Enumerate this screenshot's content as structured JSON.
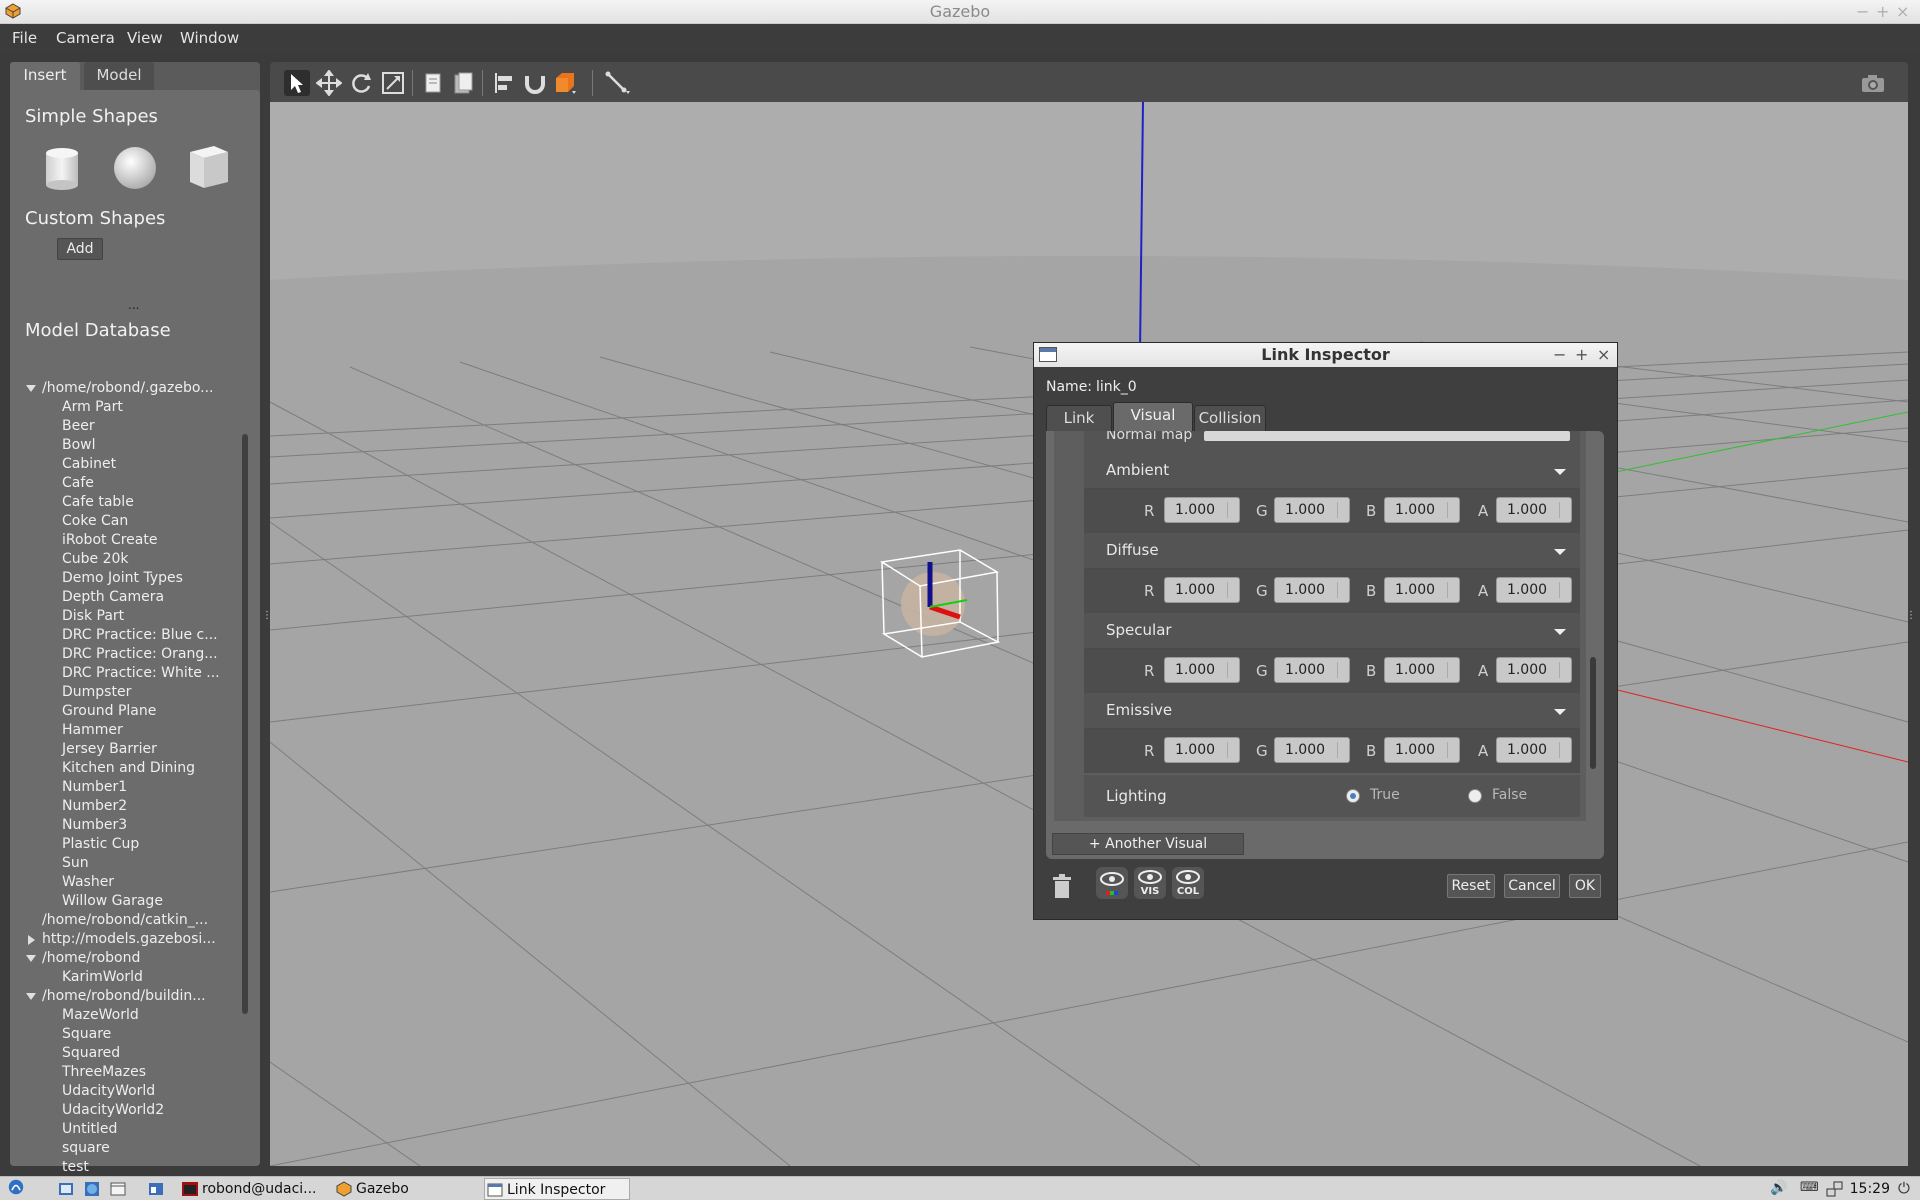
{
  "window": {
    "title": "Gazebo"
  },
  "menu": [
    {
      "label": "File",
      "mnemonic": "F"
    },
    {
      "label": "Camera",
      "mnemonic": "C"
    },
    {
      "label": "View",
      "mnemonic": "V"
    },
    {
      "label": "Window",
      "mnemonic": "W"
    }
  ],
  "left_panel": {
    "tabs": [
      "Insert",
      "Model"
    ],
    "simple_shapes_title": "Simple Shapes",
    "custom_shapes_title": "Custom Shapes",
    "add_label": "Add",
    "splitter": "...",
    "model_database_title": "Model Database",
    "tree": [
      {
        "label": "/home/robond/.gazebo...",
        "level": 0,
        "arrow": "down"
      },
      {
        "label": "Arm Part",
        "level": 1
      },
      {
        "label": "Beer",
        "level": 1
      },
      {
        "label": "Bowl",
        "level": 1
      },
      {
        "label": "Cabinet",
        "level": 1
      },
      {
        "label": "Cafe",
        "level": 1
      },
      {
        "label": "Cafe table",
        "level": 1
      },
      {
        "label": "Coke Can",
        "level": 1
      },
      {
        "label": "iRobot Create",
        "level": 1
      },
      {
        "label": "Cube 20k",
        "level": 1
      },
      {
        "label": "Demo Joint Types",
        "level": 1
      },
      {
        "label": "Depth Camera",
        "level": 1
      },
      {
        "label": "Disk Part",
        "level": 1
      },
      {
        "label": "DRC Practice: Blue c...",
        "level": 1
      },
      {
        "label": "DRC Practice: Orang...",
        "level": 1
      },
      {
        "label": "DRC Practice: White ...",
        "level": 1
      },
      {
        "label": "Dumpster",
        "level": 1
      },
      {
        "label": "Ground Plane",
        "level": 1
      },
      {
        "label": "Hammer",
        "level": 1
      },
      {
        "label": "Jersey Barrier",
        "level": 1
      },
      {
        "label": "Kitchen and Dining",
        "level": 1
      },
      {
        "label": "Number1",
        "level": 1
      },
      {
        "label": "Number2",
        "level": 1
      },
      {
        "label": "Number3",
        "level": 1
      },
      {
        "label": "Plastic Cup",
        "level": 1
      },
      {
        "label": "Sun",
        "level": 1
      },
      {
        "label": "Washer",
        "level": 1
      },
      {
        "label": "Willow Garage",
        "level": 1
      },
      {
        "label": "/home/robond/catkin_...",
        "level": 0,
        "arrow": "none"
      },
      {
        "label": "http://models.gazebosi...",
        "level": 0,
        "arrow": "right"
      },
      {
        "label": "/home/robond",
        "level": 0,
        "arrow": "down"
      },
      {
        "label": "KarimWorld",
        "level": 1
      },
      {
        "label": "/home/robond/buildin...",
        "level": 0,
        "arrow": "down"
      },
      {
        "label": "MazeWorld",
        "level": 1
      },
      {
        "label": "Square",
        "level": 1
      },
      {
        "label": "Squared",
        "level": 1
      },
      {
        "label": "ThreeMazes",
        "level": 1
      },
      {
        "label": "UdacityWorld",
        "level": 1
      },
      {
        "label": "UdacityWorld2",
        "level": 1
      },
      {
        "label": "Untitled",
        "level": 1
      },
      {
        "label": "square",
        "level": 1
      },
      {
        "label": "test",
        "level": 1
      }
    ]
  },
  "toolbar": {
    "tools": [
      "select-arrow-icon",
      "translate-icon",
      "rotate-icon",
      "scale-icon",
      "copy-icon",
      "paste-icon",
      "align-icon",
      "snap-icon",
      "change-view-icon",
      "joint-icon"
    ],
    "screenshot": "camera-icon"
  },
  "inspector": {
    "title": "Link Inspector",
    "name_label": "Name:",
    "name_value": "link_0",
    "tabs": [
      "Link",
      "Visual",
      "Collision"
    ],
    "active_tab": "Visual",
    "normal_map_label": "Normal map",
    "color_groups": [
      {
        "label": "Ambient",
        "r": "1.000",
        "g": "1.000",
        "b": "1.000",
        "a": "1.000"
      },
      {
        "label": "Diffuse",
        "r": "1.000",
        "g": "1.000",
        "b": "1.000",
        "a": "1.000"
      },
      {
        "label": "Specular",
        "r": "1.000",
        "g": "1.000",
        "b": "1.000",
        "a": "1.000"
      },
      {
        "label": "Emissive",
        "r": "1.000",
        "g": "1.000",
        "b": "1.000",
        "a": "1.000"
      }
    ],
    "channel_labels": {
      "r": "R",
      "g": "G",
      "b": "B",
      "a": "A"
    },
    "lighting": {
      "label": "Lighting",
      "true_label": "True",
      "false_label": "False",
      "value": true
    },
    "another_visual_label": "+ Another Visual",
    "vis_label": "VIS",
    "col_label": "COL",
    "reset_label": "Reset",
    "cancel_label": "Cancel",
    "ok_label": "OK"
  },
  "taskbar": {
    "items": [
      {
        "label": "robond@udaci...",
        "icon": "terminal-icon"
      },
      {
        "label": "Gazebo",
        "icon": "gazebo-icon"
      },
      {
        "label": "Link Inspector",
        "icon": "window-icon",
        "active": true
      }
    ],
    "clock": "15:29"
  },
  "colors": {
    "accent": "#4a7fc0",
    "x_axis": "#e02020",
    "y_axis": "#20c020",
    "z_axis": "#1010c0"
  }
}
